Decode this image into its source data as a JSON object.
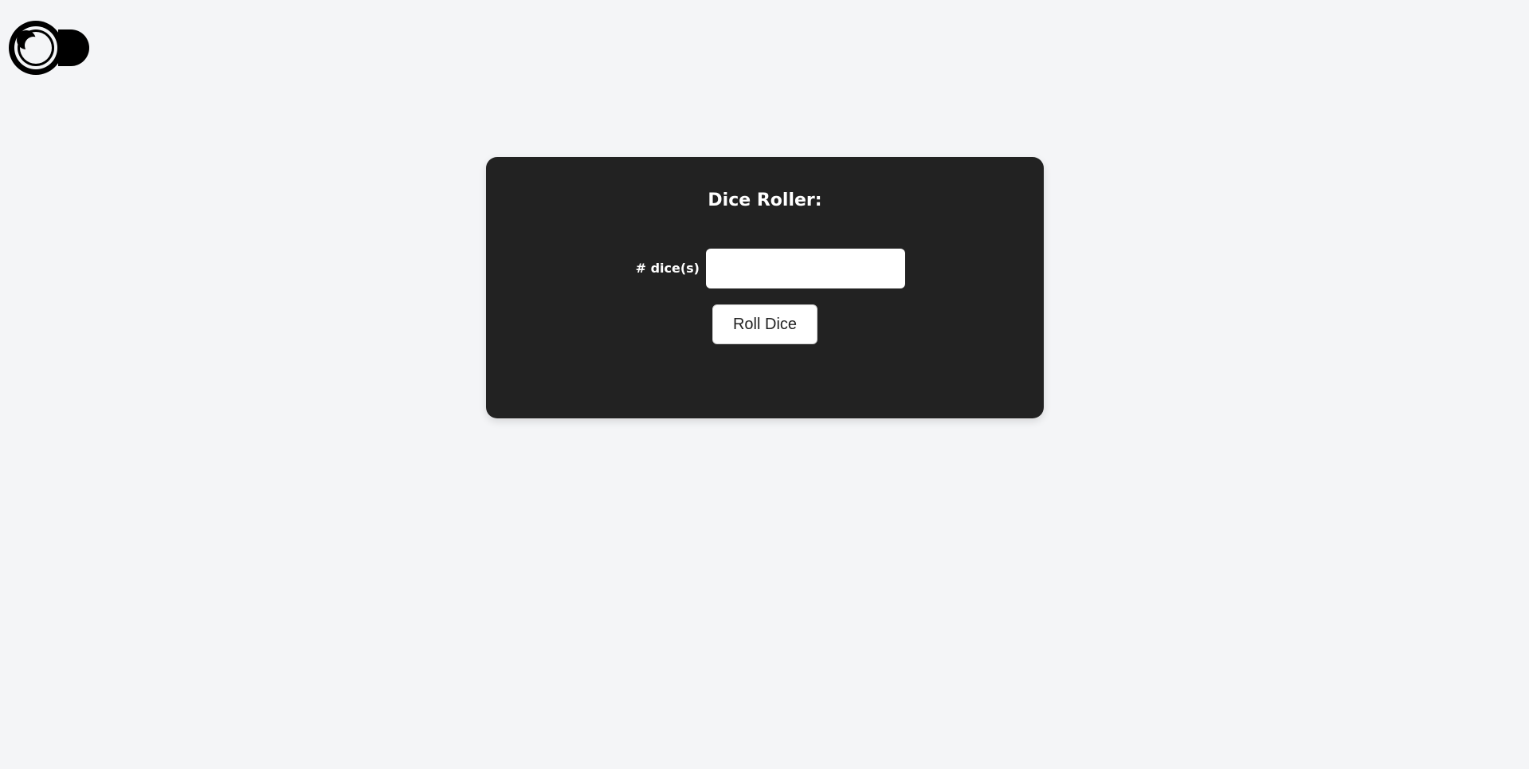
{
  "logo": {
    "icon": "moon-eye-logo-icon",
    "color": "#000000"
  },
  "card": {
    "title": "Dice Roller:",
    "background": "#222222",
    "dice_field": {
      "label": "# dice(s)",
      "value": "",
      "placeholder": ""
    },
    "roll_button_label": "Roll Dice"
  },
  "colors": {
    "page_background": "#f4f5f7",
    "card_background": "#222222",
    "text_on_card": "#ffffff"
  }
}
